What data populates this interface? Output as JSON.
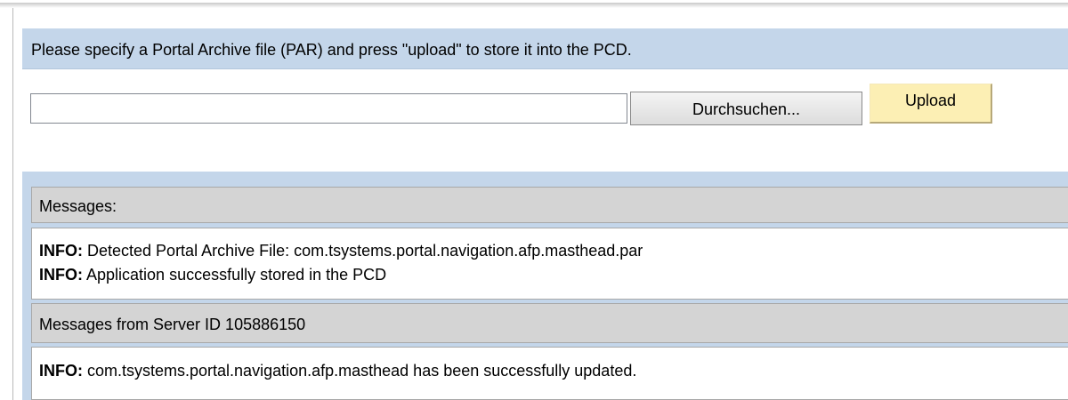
{
  "instruction": {
    "text": "Please specify a Portal Archive file (PAR) and press \"upload\" to store it into the PCD."
  },
  "upload_form": {
    "file_value": "",
    "browse_label": "Durchsuchen...",
    "upload_label": "Upload"
  },
  "messages": {
    "header": "Messages:",
    "lines": [
      {
        "level": "INFO:",
        "text": " Detected Portal Archive File: com.tsystems.portal.navigation.afp.masthead.par"
      },
      {
        "level": "INFO:",
        "text": " Application successfully stored in the PCD"
      }
    ]
  },
  "server_messages": {
    "header": "Messages from Server ID 105886150",
    "lines": [
      {
        "level": "INFO:",
        "text": " com.tsystems.portal.navigation.afp.masthead has been successfully updated."
      }
    ]
  },
  "colors": {
    "panel_blue": "#c4d6ea",
    "header_gray": "#d4d4d4",
    "upload_button_bg": "#fcefb4"
  }
}
